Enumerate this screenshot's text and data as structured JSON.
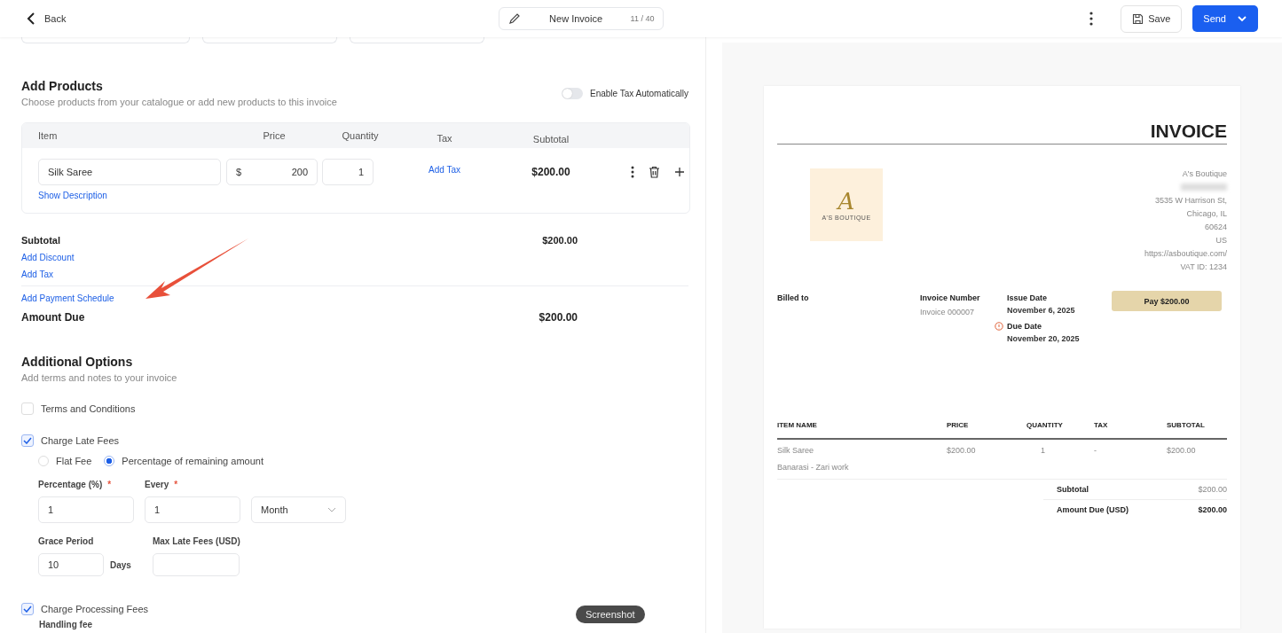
{
  "topbar": {
    "back": "Back",
    "title": "New Invoice",
    "counter": "11 / 40",
    "save": "Save",
    "send": "Send"
  },
  "products": {
    "title": "Add Products",
    "subtitle": "Choose products from your catalogue or add new products to this invoice",
    "tax_toggle": {
      "label": "Enable Tax Automatically",
      "on": false
    },
    "columns": [
      "Item",
      "Price",
      "Quantity",
      "Tax",
      "Subtotal"
    ],
    "rows": [
      {
        "item": "Silk Saree",
        "currency": "$",
        "price": "200",
        "quantity": "1",
        "tax_link": "Add Tax",
        "subtotal": "$200.00",
        "description_link": "Show Description"
      }
    ]
  },
  "totals": {
    "subtotal_label": "Subtotal",
    "subtotal": "$200.00",
    "links": [
      "Add Discount",
      "Add Tax"
    ],
    "schedule_link": "Add Payment Schedule",
    "amount_due_label": "Amount Due",
    "amount_due": "$200.00"
  },
  "options": {
    "title": "Additional Options",
    "subtitle": "Add terms and notes to your invoice",
    "terms": {
      "label": "Terms and Conditions",
      "checked": false
    },
    "late_fees": {
      "label": "Charge Late Fees",
      "checked": true,
      "types": [
        {
          "label": "Flat Fee",
          "selected": false
        },
        {
          "label": "Percentage of remaining amount",
          "selected": true
        }
      ],
      "percentage": {
        "label": "Percentage (%)",
        "required_mark": "*",
        "value": "1"
      },
      "every": {
        "label": "Every",
        "required_mark": "*",
        "value": "1",
        "period": "Month"
      },
      "grace": {
        "label": "Grace Period",
        "value": "10",
        "unit": "Days"
      },
      "max": {
        "label": "Max Late Fees (USD)"
      }
    },
    "processing": {
      "label": "Charge Processing Fees",
      "checked": true,
      "sub_label": "Handling fee"
    }
  },
  "preview": {
    "heading": "INVOICE",
    "logo": {
      "letter": "A",
      "name": "A'S BOUTIQUE"
    },
    "company": [
      "A's Boutique",
      "3535 W Harrison St,",
      "Chicago, IL",
      "60624",
      "US",
      "https://asboutique.com/",
      "VAT ID: 1234"
    ],
    "billed_to": "Billed to",
    "invoice_number_label": "Invoice Number",
    "invoice_number": "Invoice 000007",
    "issue_date_label": "Issue Date",
    "issue_date": "November 6, 2025",
    "due_date_label": "Due Date",
    "due_date": "November 20, 2025",
    "pay_button": "Pay $200.00",
    "columns": [
      "ITEM NAME",
      "PRICE",
      "QUANTITY",
      "TAX",
      "SUBTOTAL"
    ],
    "rows": [
      {
        "name": "Silk Saree",
        "description": "Banarasi - Zari work",
        "price": "$200.00",
        "quantity": "1",
        "tax": "-",
        "subtotal": "$200.00"
      }
    ],
    "subtotal_label": "Subtotal",
    "subtotal": "$200.00",
    "amount_due_label": "Amount Due (USD)",
    "amount_due": "$200.00"
  },
  "tooltip": "Screenshot"
}
